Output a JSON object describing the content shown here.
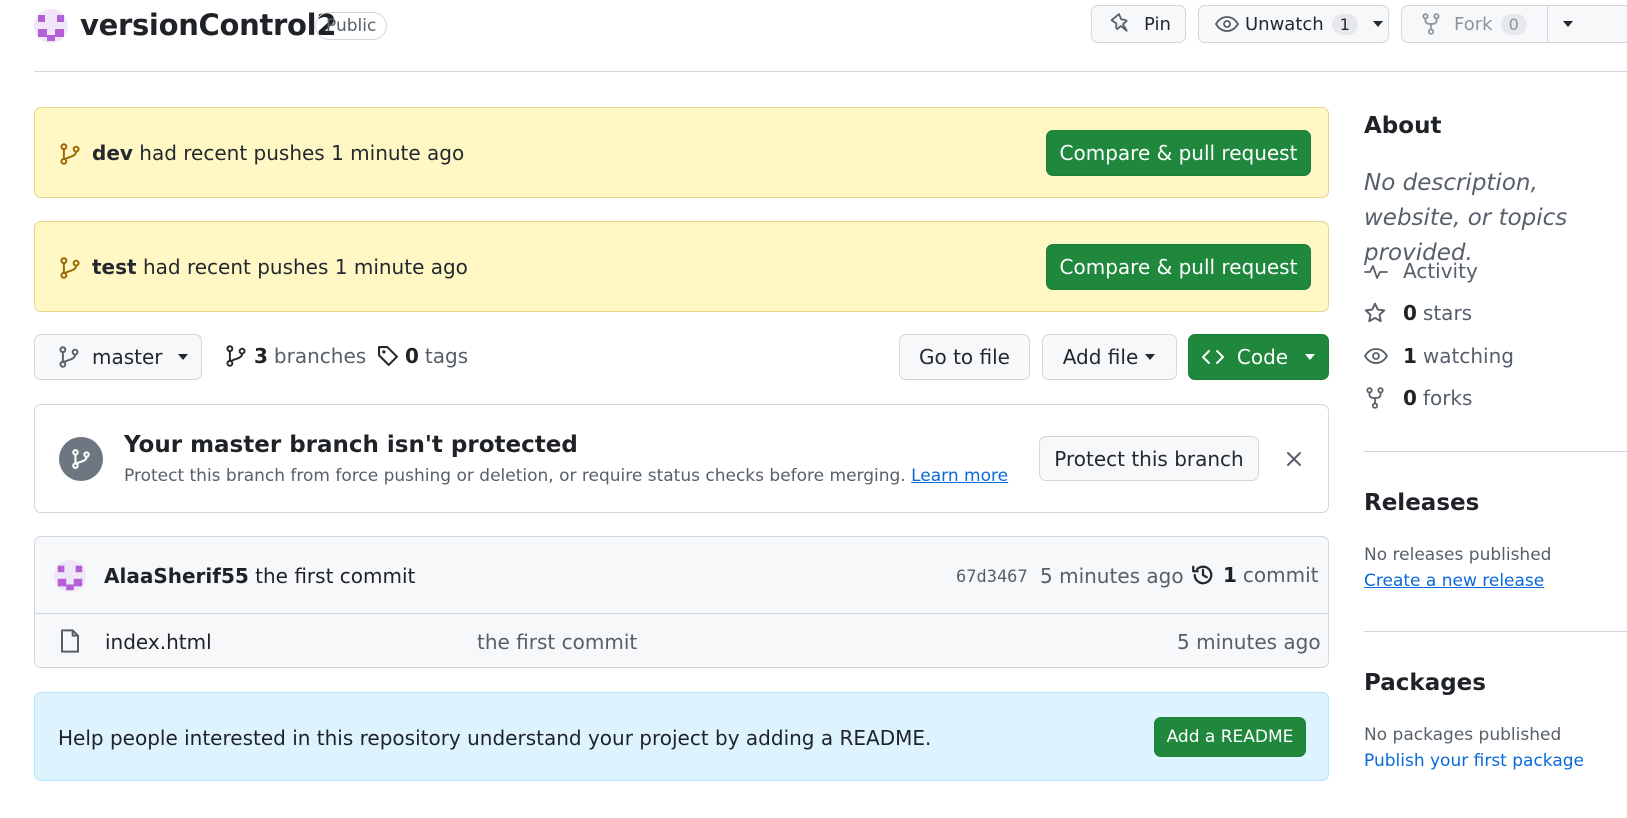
{
  "repo": {
    "name": "versionControl2",
    "visibility": "Public"
  },
  "header_actions": {
    "pin_label": "Pin",
    "unwatch_label": "Unwatch",
    "watch_count": "1",
    "fork_label": "Fork",
    "fork_count": "0"
  },
  "recent_pushes": [
    {
      "branch": "dev",
      "text": "had recent pushes 1 minute ago",
      "button": "Compare & pull request"
    },
    {
      "branch": "test",
      "text": "had recent pushes 1 minute ago",
      "button": "Compare & pull request"
    }
  ],
  "toolbar": {
    "branch": "master",
    "branch_count": "3",
    "branches_label": "branches",
    "tag_count": "0",
    "tags_label": "tags",
    "go_to_file": "Go to file",
    "add_file": "Add file",
    "code": "Code"
  },
  "protect": {
    "title": "Your master branch isn't protected",
    "description": "Protect this branch from force pushing or deletion, or require status checks before merging.",
    "learn_more": "Learn more",
    "button": "Protect this branch"
  },
  "latest_commit": {
    "author": "AlaaSherif55",
    "message": "the first commit",
    "sha": "67d3467",
    "time": "5 minutes ago",
    "commit_count": "1",
    "commit_label": "commit"
  },
  "files": [
    {
      "name": "index.html",
      "message": "the first commit",
      "time": "5 minutes ago"
    }
  ],
  "readme_prompt": {
    "text": "Help people interested in this repository understand your project by adding a README.",
    "button": "Add a README"
  },
  "sidebar": {
    "about_title": "About",
    "description": "No description, website, or topics provided.",
    "activity": "Activity",
    "stars_count": "0",
    "stars_label": "stars",
    "watching_count": "1",
    "watching_label": "watching",
    "forks_count": "0",
    "forks_label": "forks",
    "releases_title": "Releases",
    "releases_text": "No releases published",
    "releases_link": "Create a new release",
    "packages_title": "Packages",
    "packages_text": "No packages published",
    "packages_link": "Publish your first package"
  },
  "colors": {
    "accent_green": "#1f883d",
    "link_blue": "#0969da",
    "banner_yellow": "#fff8c5",
    "banner_blue": "#ddf4ff",
    "identicon_purple": "#b35fd6"
  }
}
